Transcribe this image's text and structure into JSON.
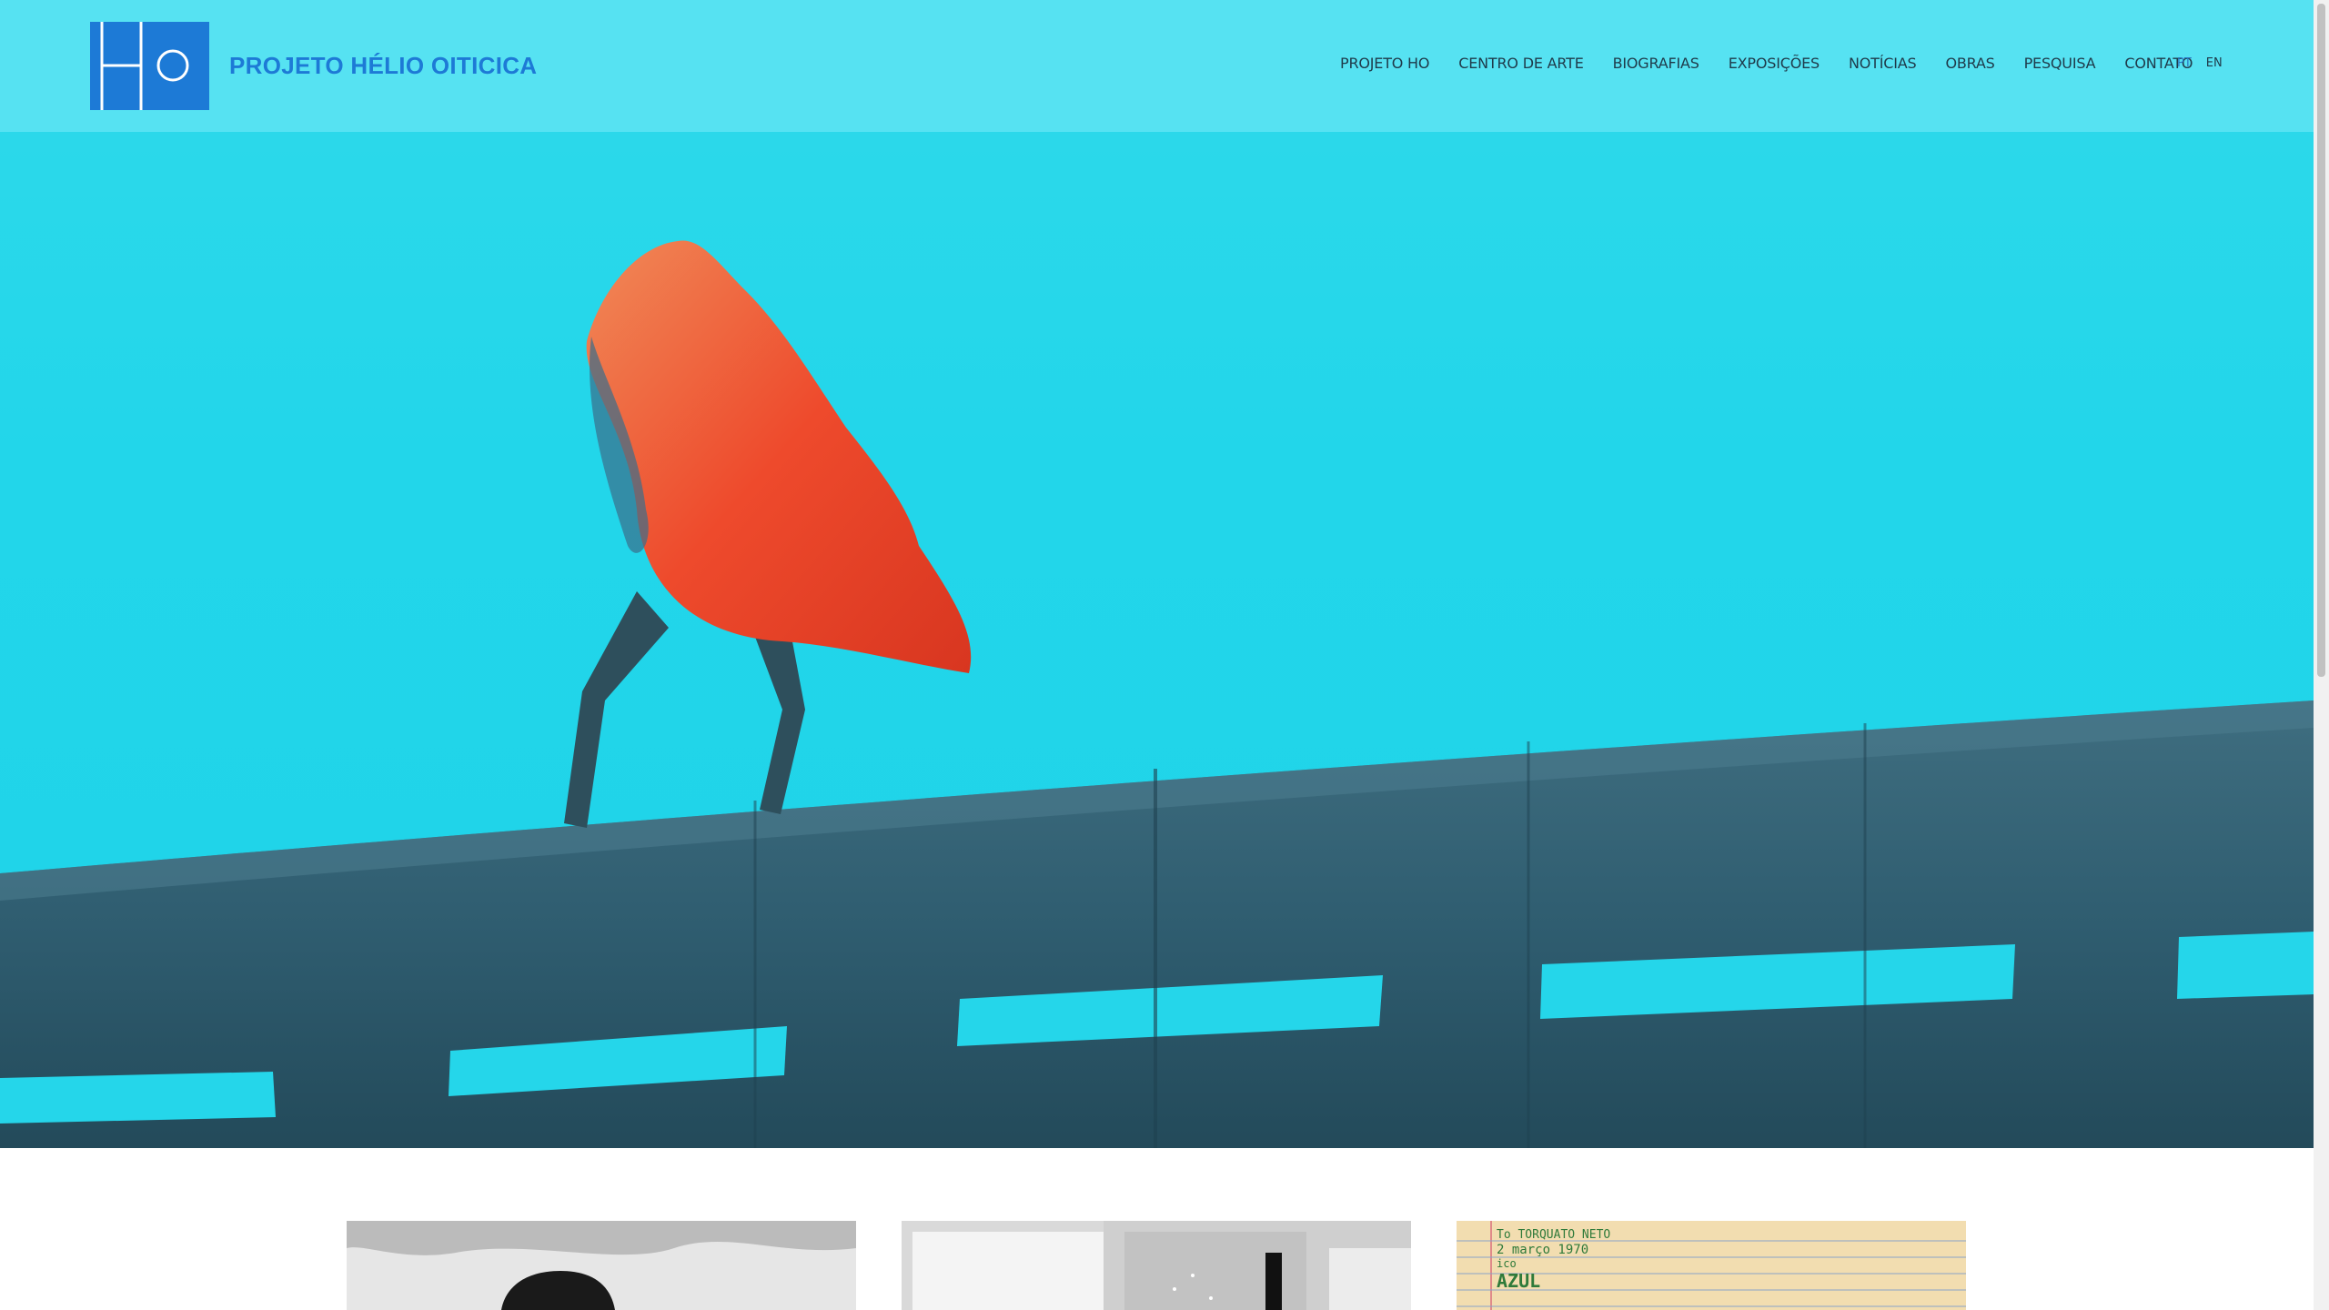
{
  "brand": {
    "name": "PROJETO HÉLIO OITICICA",
    "logo_color": "#1d7ad6"
  },
  "nav": {
    "items": [
      {
        "label": "PROJETO HO"
      },
      {
        "label": "CENTRO DE ARTE"
      },
      {
        "label": "BIOGRAFIAS"
      },
      {
        "label": "EXPOSIÇÕES"
      },
      {
        "label": "NOTÍCIAS"
      },
      {
        "label": "OBRAS"
      },
      {
        "label": "PESQUISA"
      },
      {
        "label": "CONTATO"
      }
    ]
  },
  "languages": {
    "pt": "PT",
    "en": "EN",
    "active": "PT"
  },
  "cards": [
    {
      "kind": "photo-portrait"
    },
    {
      "kind": "photo-gallery"
    },
    {
      "kind": "document",
      "handwriting": [
        "To TORQUATO NETO",
        "2 março 1970",
        "ico",
        "AZUL"
      ]
    }
  ],
  "colors": {
    "sky": "#22d6ea",
    "cape": "#e8432a",
    "nav_text": "#1f3a4a"
  }
}
